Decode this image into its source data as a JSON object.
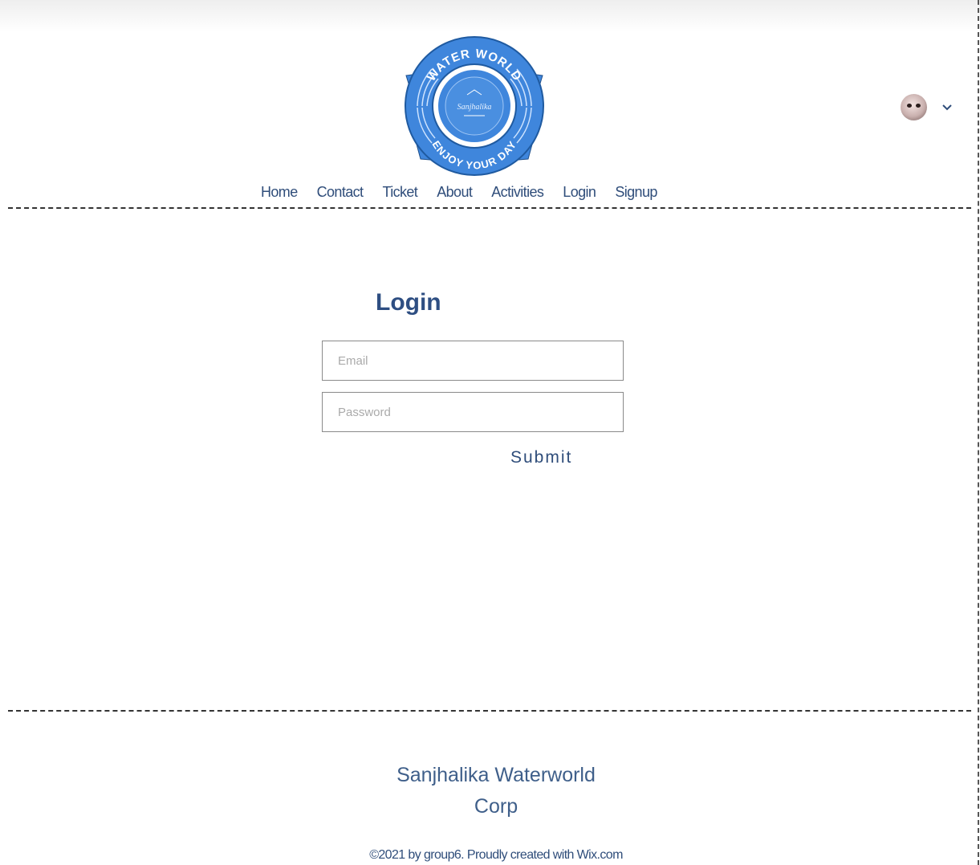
{
  "header": {
    "logo": {
      "top_text": "WATER WORLD",
      "center_text": "Sanjhalika",
      "bottom_text": "ENJOY YOUR DAY",
      "icon": "waterworld-logo"
    },
    "user_menu": {
      "avatar_icon": "user-avatar",
      "chevron_icon": "chevron-down-icon"
    }
  },
  "nav": {
    "items": [
      "Home",
      "Contact",
      "Ticket",
      "About",
      "Activities",
      "Login",
      "Signup"
    ]
  },
  "login": {
    "title": "Login",
    "email_placeholder": "Email",
    "email_value": "",
    "password_placeholder": "Password",
    "password_value": "",
    "submit_label": "Submit"
  },
  "footer": {
    "company_line1": "Sanjhalika Waterworld",
    "company_line2": "Corp",
    "copyright": "©2021 by group6. Proudly created with Wix.com"
  },
  "colors": {
    "brand_text": "#2f4d7a",
    "title": "#2e4e82",
    "logo_blue": "#3f86dc"
  }
}
